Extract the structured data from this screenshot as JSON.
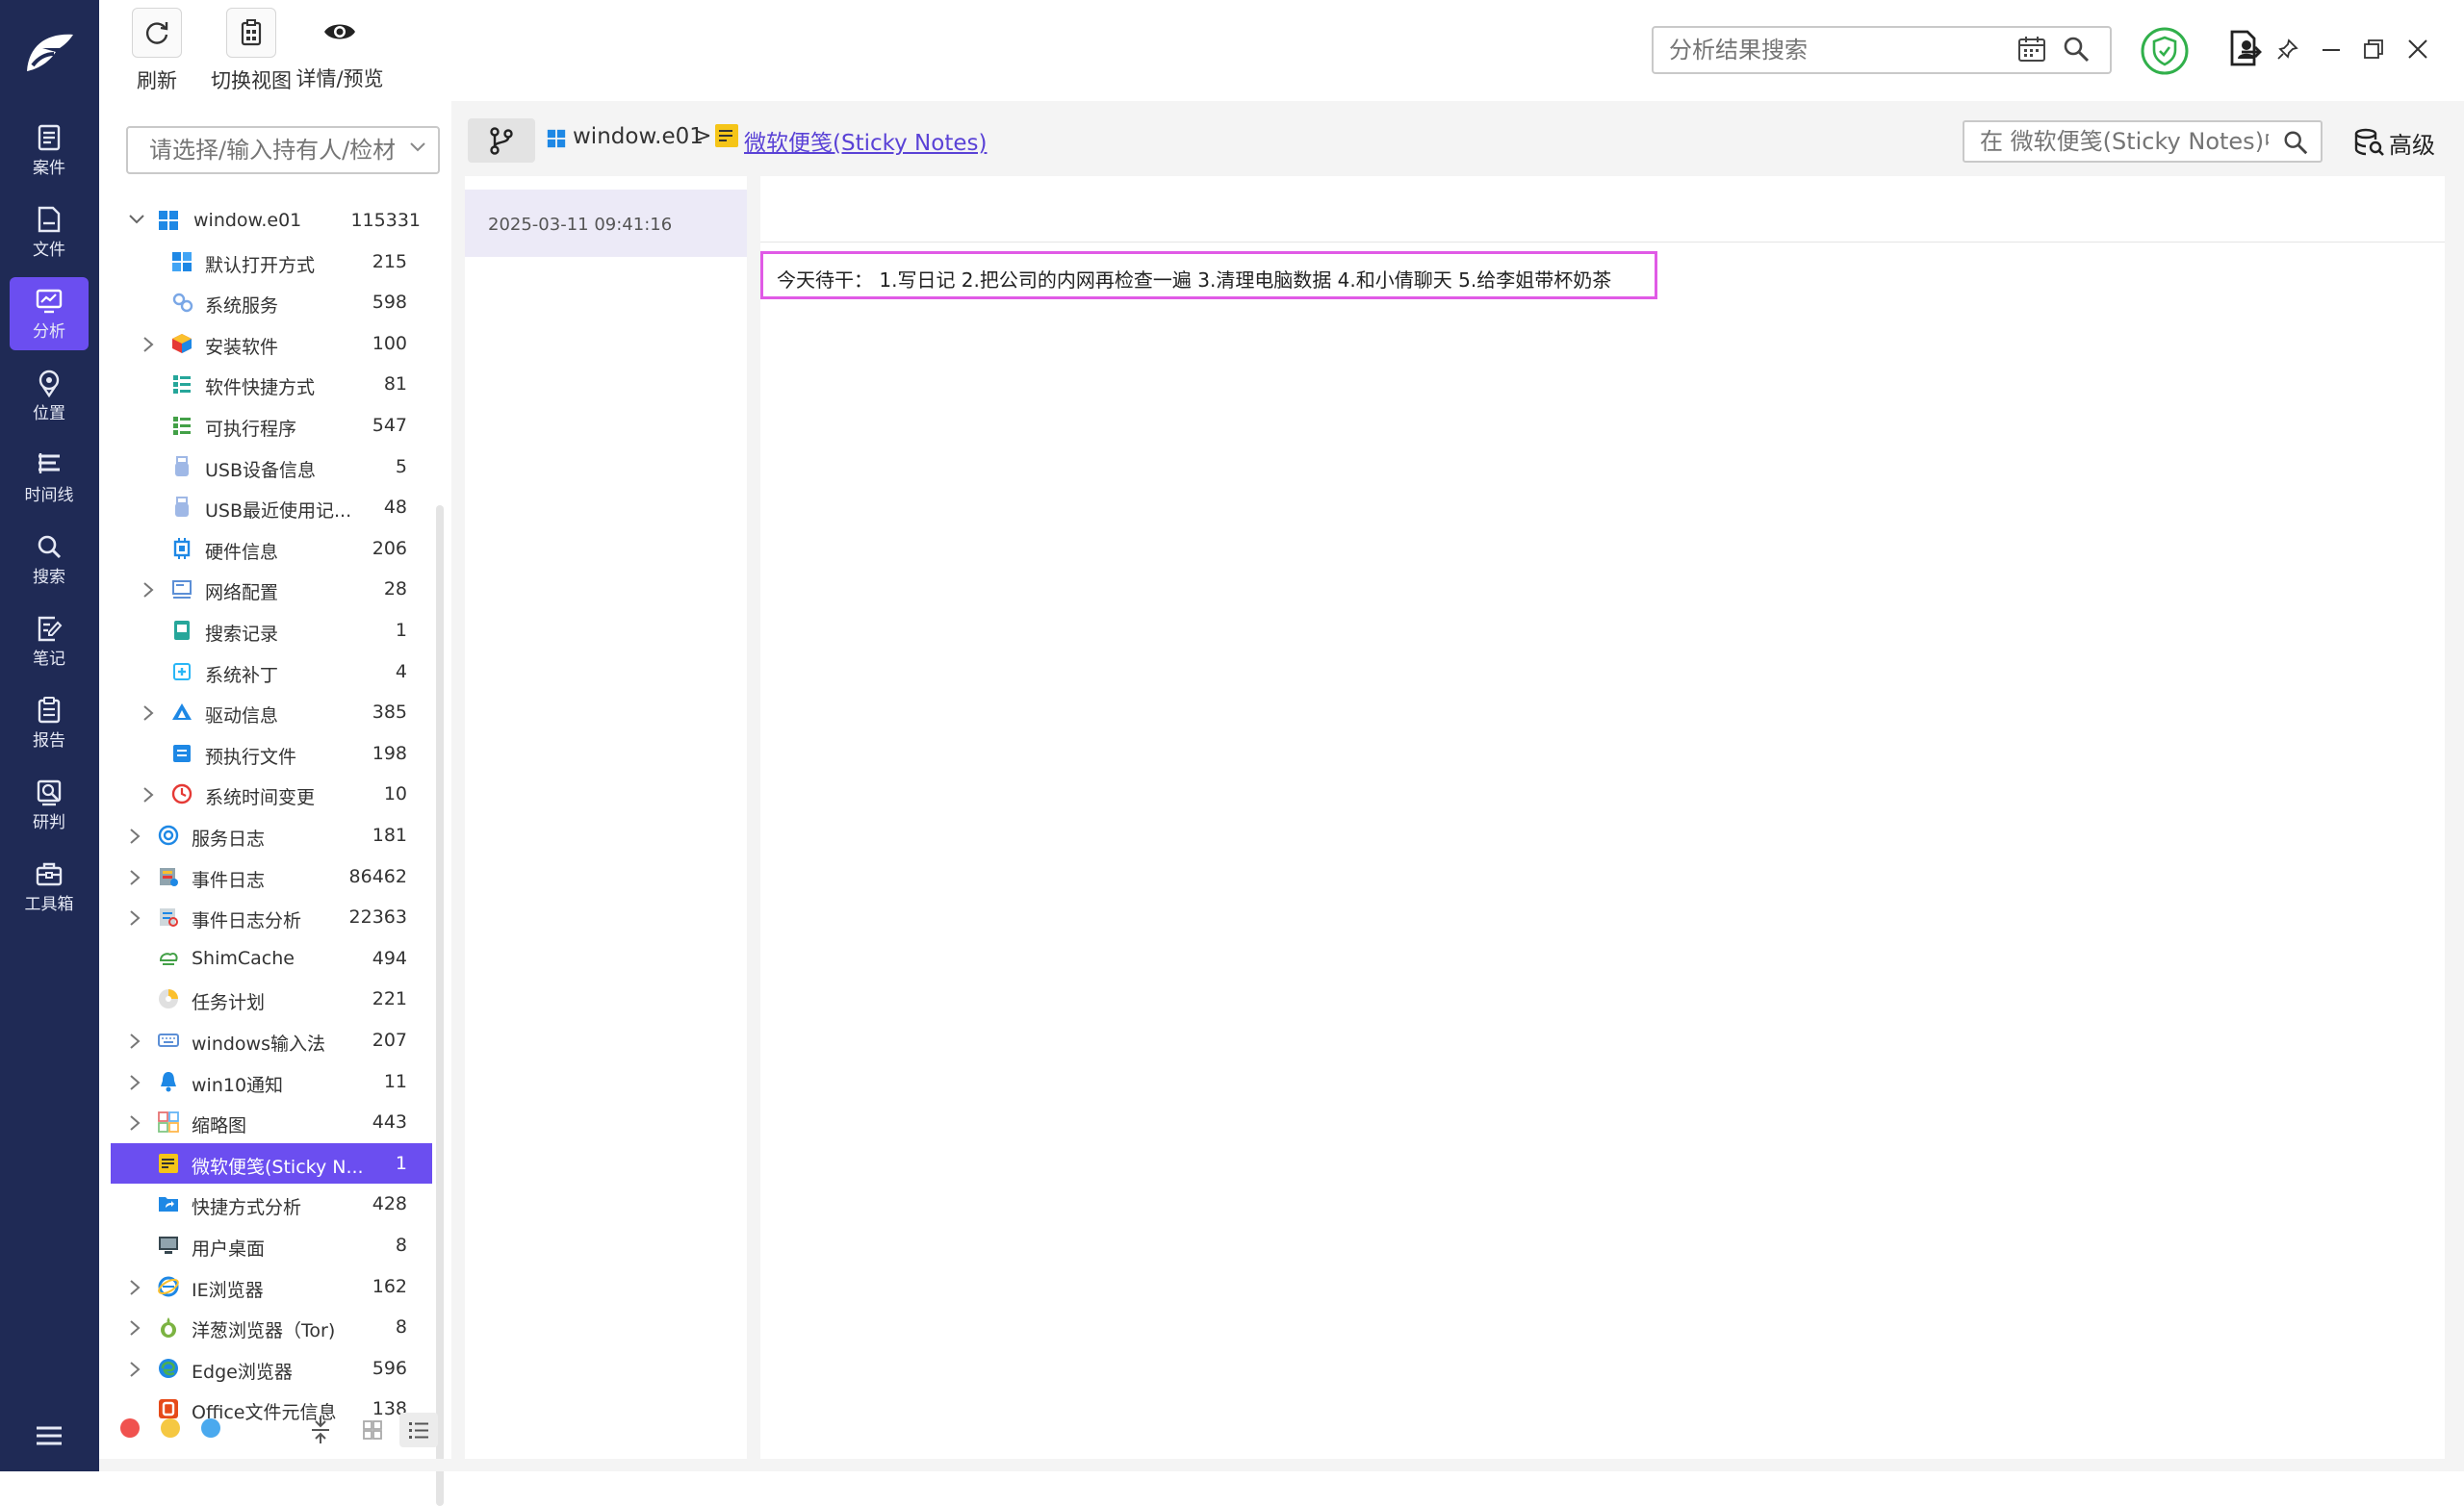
{
  "rail": {
    "items": [
      {
        "label": "案件",
        "icon": "case-icon"
      },
      {
        "label": "文件",
        "icon": "file-icon"
      },
      {
        "label": "分析",
        "icon": "analysis-icon",
        "active": true
      },
      {
        "label": "位置",
        "icon": "location-icon"
      },
      {
        "label": "时间线",
        "icon": "timeline-icon"
      },
      {
        "label": "搜索",
        "icon": "search-icon"
      },
      {
        "label": "笔记",
        "icon": "note-icon"
      },
      {
        "label": "报告",
        "icon": "report-icon"
      },
      {
        "label": "研判",
        "icon": "judge-icon"
      },
      {
        "label": "工具箱",
        "icon": "toolbox-icon"
      }
    ]
  },
  "toolbar": {
    "refresh_label": "刷新",
    "switch_view_label": "切换视图",
    "detail_preview_label": "详情/预览",
    "search_placeholder": "分析结果搜索"
  },
  "tree": {
    "owner_placeholder": "请选择/输入持有人/检材",
    "root": {
      "label": "window.e01",
      "count": "115331"
    },
    "items": [
      {
        "label": "默认打开方式",
        "count": "215",
        "icon": "default-open-icon",
        "expandable": false,
        "level": 2
      },
      {
        "label": "系统服务",
        "count": "598",
        "icon": "system-service-icon",
        "expandable": false,
        "level": 2
      },
      {
        "label": "安装软件",
        "count": "100",
        "icon": "installed-software-icon",
        "expandable": true,
        "level": 2
      },
      {
        "label": "软件快捷方式",
        "count": "81",
        "icon": "software-shortcut-icon",
        "expandable": false,
        "level": 2
      },
      {
        "label": "可执行程序",
        "count": "547",
        "icon": "executable-icon",
        "expandable": false,
        "level": 2
      },
      {
        "label": "USB设备信息",
        "count": "5",
        "icon": "usb-icon",
        "expandable": false,
        "level": 2
      },
      {
        "label": "USB最近使用记...",
        "count": "48",
        "icon": "usb-recent-icon",
        "expandable": false,
        "level": 2
      },
      {
        "label": "硬件信息",
        "count": "206",
        "icon": "hardware-icon",
        "expandable": false,
        "level": 2
      },
      {
        "label": "网络配置",
        "count": "28",
        "icon": "network-icon",
        "expandable": true,
        "level": 2
      },
      {
        "label": "搜索记录",
        "count": "1",
        "icon": "search-record-icon",
        "expandable": false,
        "level": 2
      },
      {
        "label": "系统补丁",
        "count": "4",
        "icon": "patch-icon",
        "expandable": false,
        "level": 2
      },
      {
        "label": "驱动信息",
        "count": "385",
        "icon": "driver-icon",
        "expandable": true,
        "level": 2
      },
      {
        "label": "预执行文件",
        "count": "198",
        "icon": "prefetch-icon",
        "expandable": false,
        "level": 2
      },
      {
        "label": "系统时间变更",
        "count": "10",
        "icon": "time-change-icon",
        "expandable": true,
        "level": 2
      },
      {
        "label": "服务日志",
        "count": "181",
        "icon": "service-log-icon",
        "expandable": true,
        "level": 1
      },
      {
        "label": "事件日志",
        "count": "86462",
        "icon": "event-log-icon",
        "expandable": true,
        "level": 1
      },
      {
        "label": "事件日志分析",
        "count": "22363",
        "icon": "event-analysis-icon",
        "expandable": true,
        "level": 1
      },
      {
        "label": "ShimCache",
        "count": "494",
        "icon": "shimcache-icon",
        "expandable": false,
        "level": 1
      },
      {
        "label": "任务计划",
        "count": "221",
        "icon": "task-schedule-icon",
        "expandable": false,
        "level": 1
      },
      {
        "label": "windows输入法",
        "count": "207",
        "icon": "ime-icon",
        "expandable": true,
        "level": 1
      },
      {
        "label": "win10通知",
        "count": "11",
        "icon": "notification-icon",
        "expandable": true,
        "level": 1
      },
      {
        "label": "缩略图",
        "count": "443",
        "icon": "thumbnail-icon",
        "expandable": true,
        "level": 1
      },
      {
        "label": "微软便笺(Sticky N...",
        "count": "1",
        "icon": "sticky-notes-icon",
        "expandable": false,
        "level": 1,
        "selected": true
      },
      {
        "label": "快捷方式分析",
        "count": "428",
        "icon": "shortcut-analysis-icon",
        "expandable": false,
        "level": 1
      },
      {
        "label": "用户桌面",
        "count": "8",
        "icon": "desktop-icon",
        "expandable": false,
        "level": 1
      },
      {
        "label": "IE浏览器",
        "count": "162",
        "icon": "ie-icon",
        "expandable": true,
        "level": 1
      },
      {
        "label": "洋葱浏览器（Tor)",
        "count": "8",
        "icon": "tor-icon",
        "expandable": true,
        "level": 1
      },
      {
        "label": "Edge浏览器",
        "count": "596",
        "icon": "edge-icon",
        "expandable": true,
        "level": 1
      },
      {
        "label": "Office文件元信息",
        "count": "138",
        "icon": "office-icon",
        "expandable": false,
        "level": 1
      }
    ]
  },
  "colors": {
    "rail_bg": "#1f2a55",
    "accent": "#6b4ef0",
    "highlight_border": "#e05ae6",
    "dot_red": "#f0524f",
    "dot_yellow": "#f5c842",
    "dot_blue": "#4aa9ee"
  },
  "content": {
    "breadcrumb_root": "window.e01",
    "breadcrumb_sep": ">",
    "breadcrumb_current": "微软便笺(Sticky Notes)",
    "search_placeholder": "在 微软便笺(Sticky Notes)中搜索",
    "advanced_label": "高级",
    "record_time": "2025-03-11 09:41:16",
    "note_text": "今天待干： 1.写日记 2.把公司的内网再检查一遍 3.清理电脑数据 4.和小倩聊天 5.给李姐带杯奶茶"
  }
}
